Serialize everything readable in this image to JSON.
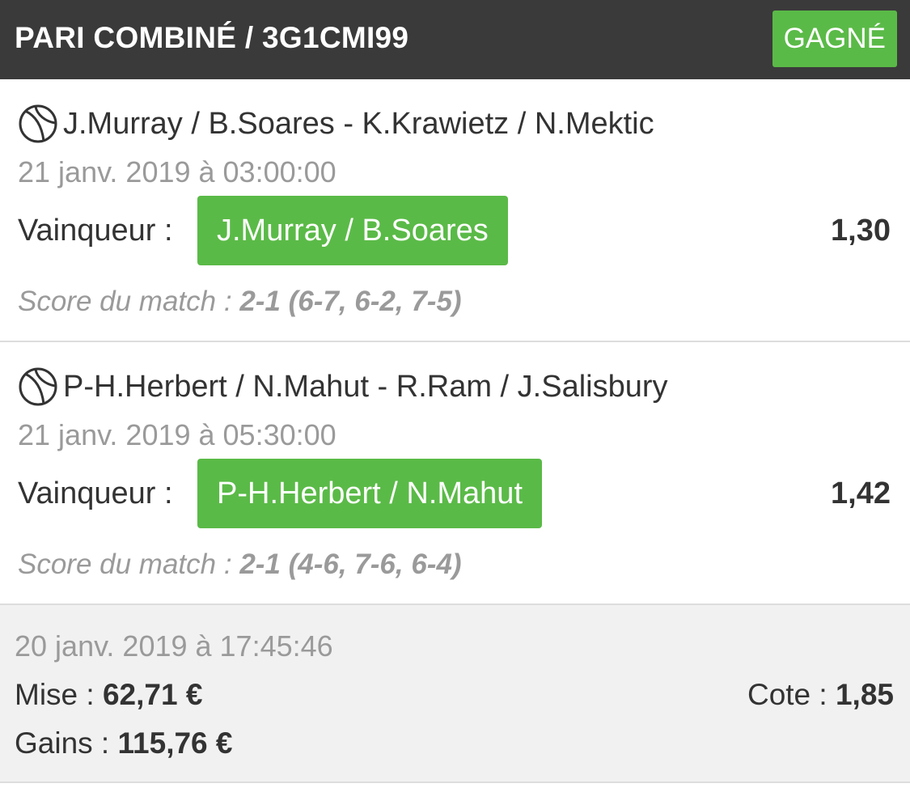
{
  "header": {
    "title": "PARI COMBINÉ / 3G1CMI99",
    "status": "GAGNÉ"
  },
  "colors": {
    "header_bg": "#3a3a3a",
    "accent_green": "#5aba47",
    "muted_text": "#9a9a9a",
    "summary_bg": "#f1f1f1"
  },
  "matches": [
    {
      "icon": "tennis-ball-icon",
      "name": "J.Murray / B.Soares - K.Krawietz / N.Mektic",
      "date": "21 janv. 2019 à 03:00:00",
      "bet_label": "Vainqueur :",
      "selection": "J.Murray / B.Soares",
      "odds": "1,30",
      "score_label": "Score du match :",
      "score": "2-1 (6-7, 6-2, 7-5)"
    },
    {
      "icon": "tennis-ball-icon",
      "name": "P-H.Herbert / N.Mahut - R.Ram / J.Salisbury",
      "date": "21 janv. 2019 à 05:30:00",
      "bet_label": "Vainqueur :",
      "selection": "P-H.Herbert / N.Mahut",
      "odds": "1,42",
      "score_label": "Score du match :",
      "score": "2-1 (4-6, 7-6, 6-4)"
    }
  ],
  "summary": {
    "date": "20 janv. 2019 à 17:45:46",
    "stake_label": "Mise  :",
    "stake_value": "62,71 €",
    "gains_label": "Gains :",
    "gains_value": "115,76 €",
    "odds_label": "Cote :",
    "odds_value": "1,85"
  }
}
